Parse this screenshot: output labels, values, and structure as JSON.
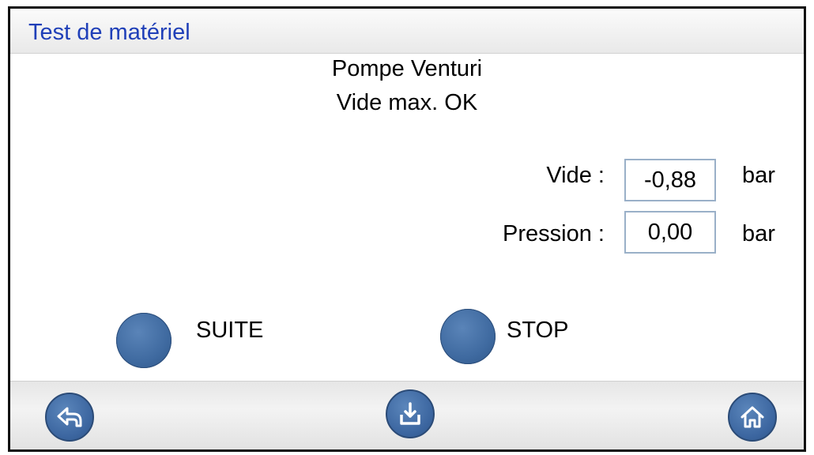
{
  "header": {
    "title": "Test de matériel"
  },
  "main": {
    "line1": "Pompe Venturi",
    "line2": "Vide max. OK",
    "readings": [
      {
        "label": "Vide :",
        "value": "-0,88",
        "unit": "bar"
      },
      {
        "label": "Pression :",
        "value": "0,00",
        "unit": "bar"
      }
    ],
    "buttons": {
      "suite": "SUITE",
      "stop": "STOP"
    }
  },
  "footer": {
    "icons": {
      "back": "back-arrow-icon",
      "download": "download-icon",
      "home": "home-icon"
    }
  },
  "colors": {
    "title": "#1f3fb8",
    "button": "#3f6aa0",
    "field_border": "#9ab0c8"
  }
}
